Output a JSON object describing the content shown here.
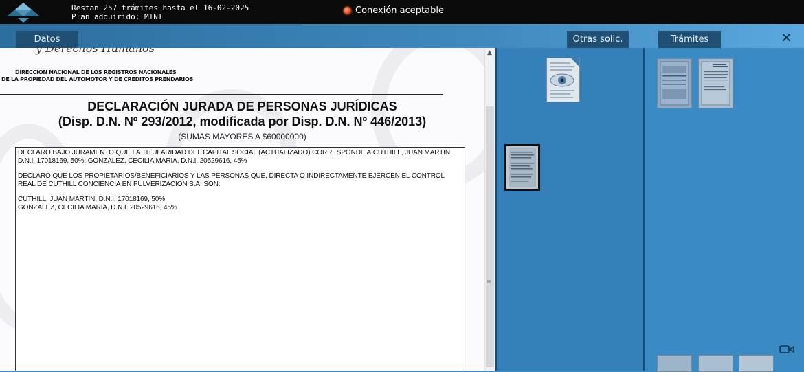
{
  "header": {
    "quota_text": "Restan 257 trámites hasta el 16-02-2025",
    "plan_text": "Plan adquirido: MINI",
    "connection_status": "Conexión aceptable",
    "connection_icon": "status-dot-icon"
  },
  "tabs": {
    "datos": "Datos",
    "otras": "Otras solic.",
    "tramites": "Trámites",
    "close_icon": "close-icon"
  },
  "document": {
    "header_partial": "y Derechos Humanos",
    "direccion_line1": "DIRECCION NACIONAL DE LOS REGISTROS NACIONALES",
    "direccion_line2": "DE LA PROPIEDAD DEL AUTOMOTOR Y DE CREDITOS PRENDARIOS",
    "title_line1": "DECLARACIÓN JURADA DE PERSONAS JURÍDICAS",
    "title_line2": "(Disp. D.N. Nº 293/2012, modificada por Disp. D.N. Nº 446/2013)",
    "subtitle": "(SUMAS MAYORES A $60000000)",
    "paragraph1": "DECLARO BAJO JURAMENTO QUE LA TITULARIDAD DEL CAPITAL SOCIAL (ACTUALIZADO) CORRESPONDE A:CUTHILL, JUAN MARTIN, D.N.I. 17018169, 50%; GONZALEZ, CECILIA MARIA, D.N.I. 20529616, 45%",
    "paragraph2": "DECLARO QUE LOS PROPIETARIOS/BENEFICIARIOS Y LAS PERSONAS QUE, DIRECTA O INDIRECTAMENTE EJERCEN EL CONTROL REAL DE CUTHILL CONCIENCIA EN PULVERIZACION S.A. SON:",
    "person1": "CUTHILL, JUAN MARTIN, D.N.I. 17018169, 50%",
    "person2": "GONZALEZ, CECILIA MARIA, D.N.I. 20529616, 45%"
  },
  "colors": {
    "topbar": "#0a0a0a",
    "tab": "#1f4f72",
    "pane": "#3580b9"
  }
}
